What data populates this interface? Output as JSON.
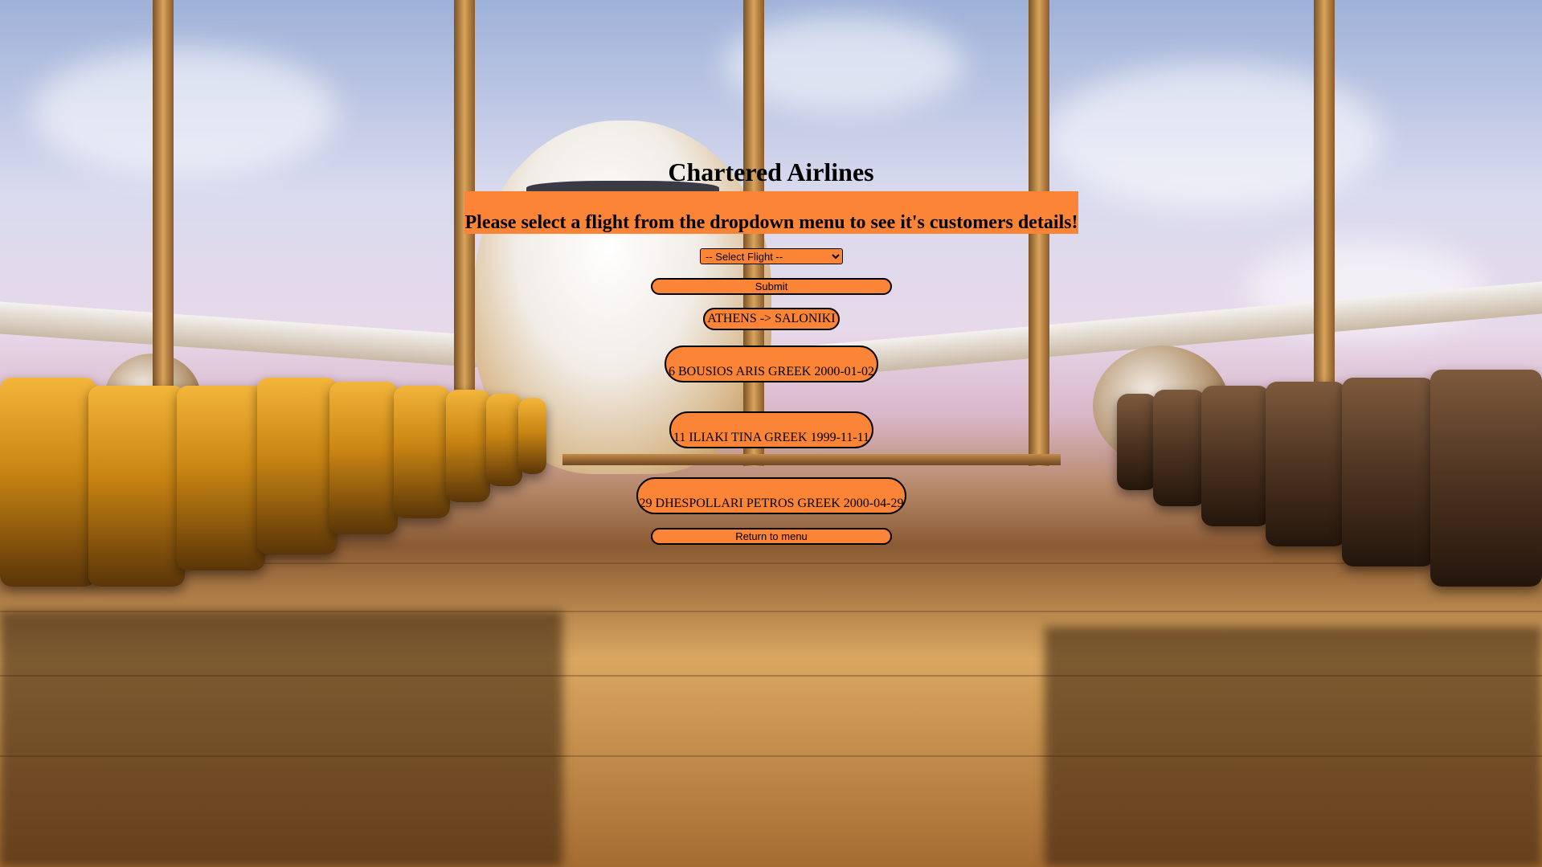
{
  "page": {
    "title": "Chartered Airlines",
    "instruction": "Please select a flight from the dropdown menu to see it's customers details!"
  },
  "form": {
    "select_placeholder": "-- Select Flight --",
    "submit_label": "Submit"
  },
  "results": {
    "route": "ATHENS -> SALONIKI",
    "customers": [
      "6 BOUSIOS ARIS GREEK 2000-01-02",
      "11 ILIAKI TINA GREEK 1999-11-11",
      "29 DHESPOLLARI PETROS GREEK 2000-04-29"
    ]
  },
  "footer": {
    "return_label": "Return to menu"
  },
  "colors": {
    "accent": "#fc8436",
    "border": "#000000"
  }
}
